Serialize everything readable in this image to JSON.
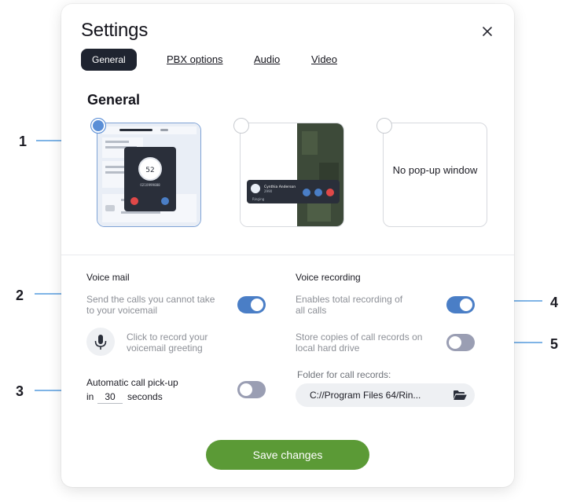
{
  "dialog": {
    "title": "Settings",
    "close_icon": "close-icon",
    "tabs": [
      {
        "label": "General",
        "active": true
      },
      {
        "label": "PBX options",
        "active": false
      },
      {
        "label": "Audio",
        "active": false
      },
      {
        "label": "Video",
        "active": false
      }
    ],
    "section_title": "General",
    "popup_options": {
      "selected_index": 0,
      "third_label": "No pop-up window",
      "window_preview": {
        "timer": "52",
        "caller_number": "0210999888"
      },
      "compact_preview": {
        "caller_name": "Cynthia Anderson",
        "caller_line": "2990",
        "status": "Ringing"
      }
    },
    "voice_mail": {
      "heading": "Voice mail",
      "send_calls_text": "Send the calls you cannot take to your voicemail",
      "send_calls_on": true,
      "record_greeting_text": "Click to record your voicemail greeting",
      "mic_icon": "microphone-icon"
    },
    "auto_pickup": {
      "label_prefix": "Automatic call pick-up",
      "label_in": "in",
      "seconds_value": "30",
      "label_suffix": "seconds",
      "enabled": false
    },
    "voice_recording": {
      "heading": "Voice recording",
      "total_recording_text": "Enables total recording of all calls",
      "total_recording_on": true,
      "local_copies_text": "Store copies of call records on local hard drive",
      "local_copies_on": false,
      "folder_label": "Folder for call records:",
      "folder_path": "C://Program Files 64/Rin...",
      "folder_icon": "folder-open-icon"
    },
    "save_label": "Save changes"
  },
  "callouts": [
    "1",
    "2",
    "3",
    "4",
    "5"
  ],
  "colors": {
    "accent_blue": "#4a7ec6",
    "save_green": "#5b9a36",
    "callout_blue": "#7fb4e6",
    "tab_active_bg": "#1f2430"
  }
}
